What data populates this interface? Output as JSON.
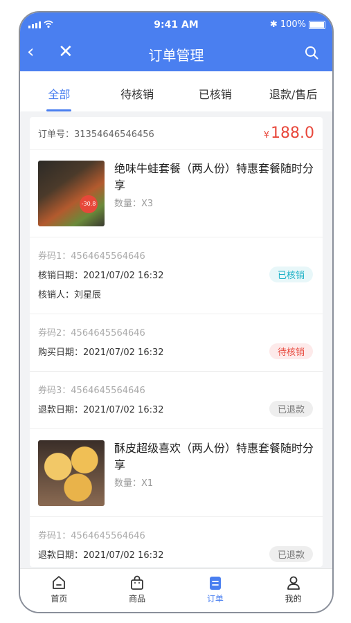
{
  "status_bar": {
    "time": "9:41 AM",
    "battery": "100%",
    "bluetooth": "✱"
  },
  "nav": {
    "title": "订单管理",
    "back": "‹",
    "close": "✕"
  },
  "tabs": [
    {
      "label": "全部",
      "active": true
    },
    {
      "label": "待核销",
      "active": false
    },
    {
      "label": "已核销",
      "active": false
    },
    {
      "label": "退款/售后",
      "active": false
    }
  ],
  "order": {
    "no_label": "订单号：",
    "no": "31354646546456",
    "currency": "¥",
    "price": "188.0",
    "products": [
      {
        "name": "绝味牛蛙套餐（两人份）特惠套餐随时分享",
        "qty_label": "数量：",
        "qty": "X3"
      },
      {
        "name": "酥皮超级喜欢（两人份）特惠套餐随时分享",
        "qty_label": "数量：",
        "qty": "X1"
      }
    ],
    "coupons": [
      {
        "code": "券码1：4564645564646",
        "date": "核销日期：2021/07/02 16:32",
        "person": "核销人：刘星辰",
        "status": "已核销"
      },
      {
        "code": "券码2：4564645564646",
        "date": "购买日期：2021/07/02 16:32",
        "status": "待核销"
      },
      {
        "code": "券码3：4564645564646",
        "date": "退款日期：2021/07/02 16:32",
        "status": "已退款"
      },
      {
        "code": "券码1：4564645564646",
        "date": "退款日期：2021/07/02 16:32",
        "status": "已退款"
      }
    ]
  },
  "tabbar": [
    {
      "label": "首页",
      "icon": "home-icon"
    },
    {
      "label": "商品",
      "icon": "bag-icon"
    },
    {
      "label": "订单",
      "icon": "order-icon",
      "active": true
    },
    {
      "label": "我的",
      "icon": "user-icon"
    }
  ],
  "colors": {
    "primary": "#4a7ff0",
    "price": "#e8483c",
    "done": "#1cb1c6",
    "pending": "#e8483c",
    "refund": "#777777"
  }
}
